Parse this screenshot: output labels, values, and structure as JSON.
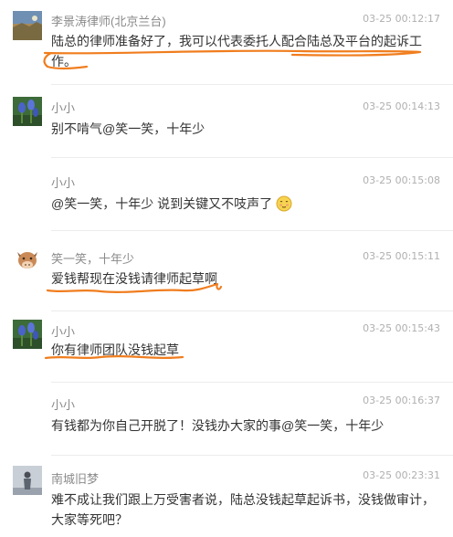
{
  "comments": [
    {
      "user": "李景涛律师(北京兰台)",
      "time": "03-25 00:12:17",
      "text": "陆总的律师准备好了，我可以代表委托人配合陆总及平台的起诉工作。",
      "avatar_icon": "landscape-avatar-icon"
    },
    {
      "user": "小小",
      "time": "03-25 00:14:13",
      "text": "别不啃气@笑一笑，十年少",
      "avatar_icon": "flower-avatar-icon"
    },
    {
      "user": "小小",
      "time": "03-25 00:15:08",
      "text": "@笑一笑，十年少 说到关键又不吱声了",
      "avatar_icon": "",
      "emoji": "blush-emoji-icon"
    },
    {
      "user": "笑一笑，十年少",
      "time": "03-25 00:15:11",
      "text": "爱钱帮现在没钱请律师起草啊",
      "avatar_icon": "cow-avatar-icon"
    },
    {
      "user": "小小",
      "time": "03-25 00:15:43",
      "text": "你有律师团队没钱起草",
      "avatar_icon": "flower-avatar-icon"
    },
    {
      "user": "小小",
      "time": "03-25 00:16:37",
      "text": "有钱都为你自己开脱了！没钱办大家的事@笑一笑，十年少",
      "avatar_icon": ""
    },
    {
      "user": "南城旧梦",
      "time": "03-25 00:23:31",
      "text": "难不成让我们跟上万受害者说，陆总没钱起草起诉书，没钱做审计，大家等死吧？",
      "avatar_icon": "person-avatar-icon"
    }
  ],
  "colors": {
    "highlight": "#f07d1e",
    "username": "#8a8a8a",
    "timestamp": "#b0b0b0",
    "text": "#333333"
  }
}
